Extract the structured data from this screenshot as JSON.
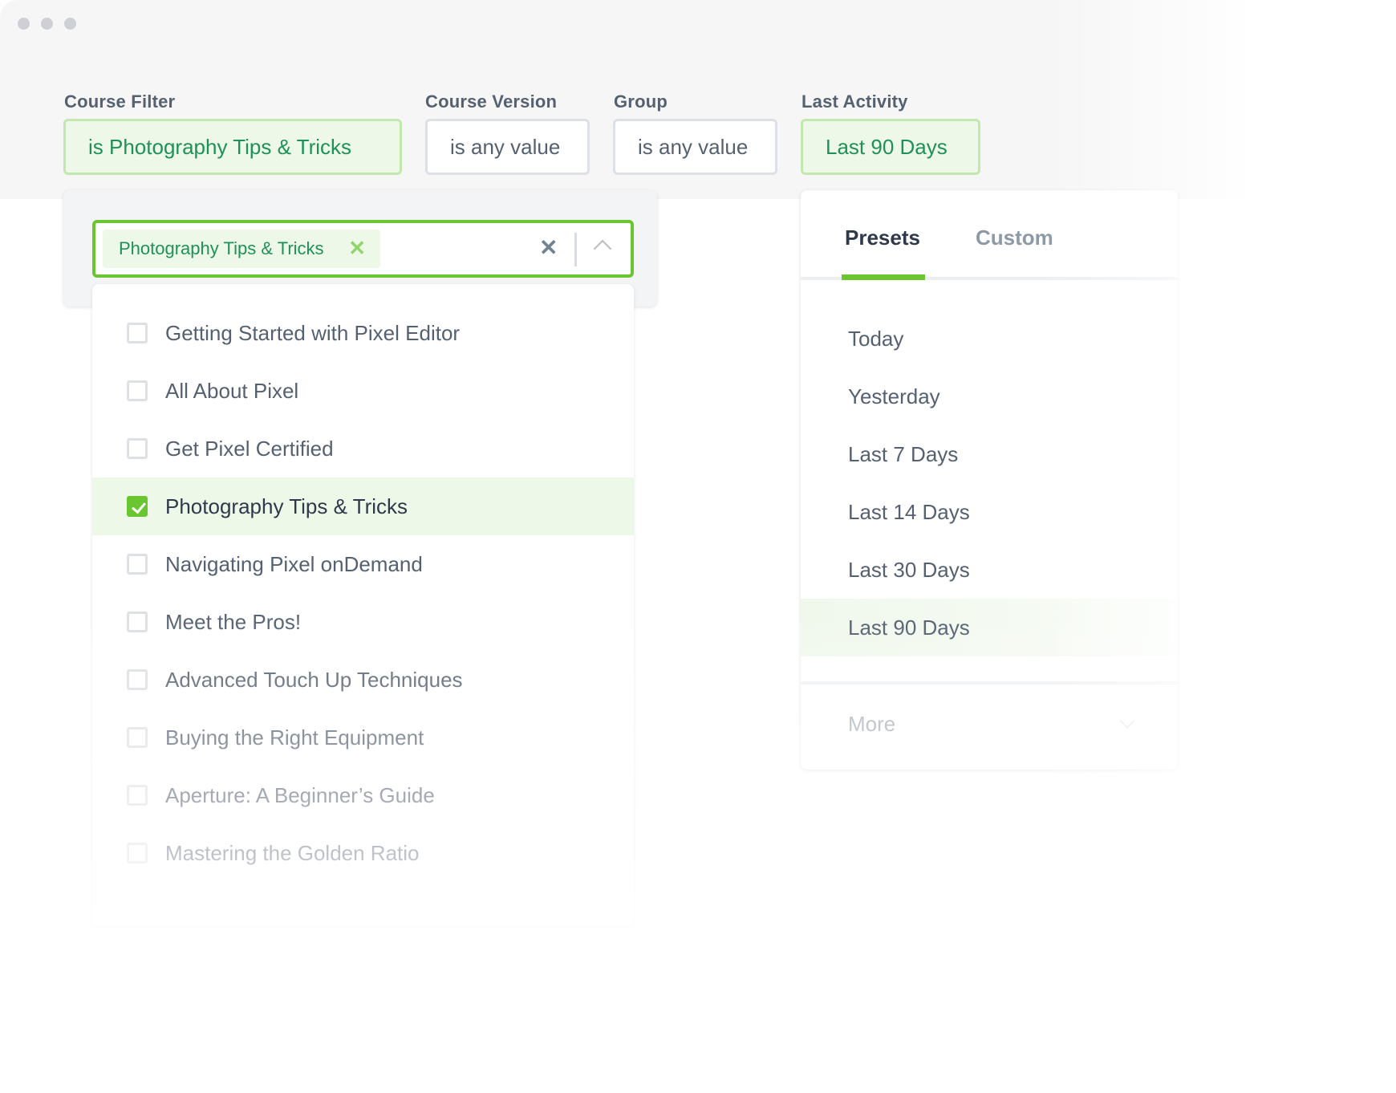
{
  "window": {
    "controls": [
      "close",
      "minimize",
      "maximize"
    ]
  },
  "filters": {
    "course_filter": {
      "label": "Course Filter",
      "value": "is Photography Tips & Tricks",
      "state": "active"
    },
    "course_version": {
      "label": "Course Version",
      "value": "is any value",
      "state": "default"
    },
    "group": {
      "label": "Group",
      "value": "is any value",
      "state": "default"
    },
    "last_activity": {
      "label": "Last Activity",
      "value": "Last 90 Days",
      "state": "active"
    }
  },
  "course_dropdown": {
    "selected_chip": {
      "label": "Photography Tips & Tricks",
      "remove_icon": "x-icon"
    },
    "clear_icon": "x-icon",
    "toggle_icon": "chevron-up-icon",
    "options": [
      {
        "label": "Getting Started with Pixel Editor",
        "checked": false
      },
      {
        "label": "All About Pixel",
        "checked": false
      },
      {
        "label": "Get Pixel Certified",
        "checked": false
      },
      {
        "label": "Photography Tips & Tricks",
        "checked": true
      },
      {
        "label": "Navigating Pixel onDemand",
        "checked": false
      },
      {
        "label": "Meet the Pros!",
        "checked": false
      },
      {
        "label": "Advanced Touch Up Techniques",
        "checked": false
      },
      {
        "label": "Buying the Right Equipment",
        "checked": false
      },
      {
        "label": "Aperture: A Beginner’s Guide",
        "checked": false
      },
      {
        "label": "Mastering the Golden Ratio",
        "checked": false
      }
    ]
  },
  "date_dropdown": {
    "tabs": [
      {
        "label": "Presets",
        "active": true
      },
      {
        "label": "Custom",
        "active": false
      }
    ],
    "presets": [
      {
        "label": "Today",
        "selected": false
      },
      {
        "label": "Yesterday",
        "selected": false
      },
      {
        "label": "Last 7 Days",
        "selected": false
      },
      {
        "label": "Last 14 Days",
        "selected": false
      },
      {
        "label": "Last 30 Days",
        "selected": false
      },
      {
        "label": "Last 90 Days",
        "selected": true
      }
    ],
    "more": {
      "label": "More",
      "icon": "chevron-down-icon"
    }
  },
  "colors": {
    "accent_green": "#69c630",
    "active_text_green": "#1e9158",
    "active_bg": "#eef8e9",
    "text_slate": "#556171"
  }
}
